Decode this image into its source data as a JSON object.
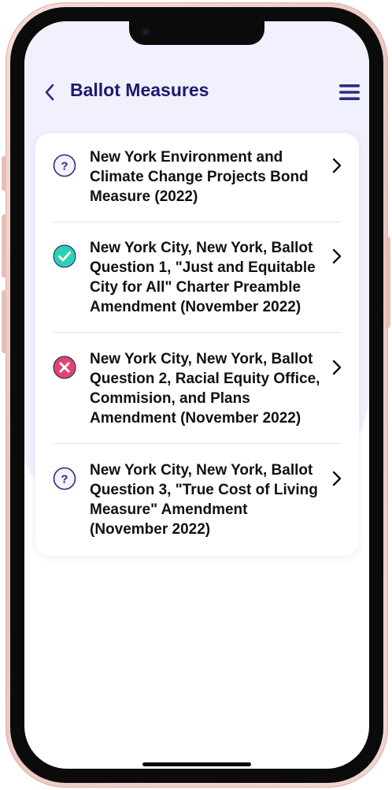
{
  "header": {
    "title": "Ballot Measures",
    "back_icon": "chevron-left-icon",
    "menu_icon": "hamburger-menu-icon"
  },
  "colors": {
    "title": "#1c1a6e",
    "accent": "#2e2a82",
    "check": "#2ad1b2",
    "cross": "#e0456f",
    "screen_tint": "#f0f1fd"
  },
  "measures": [
    {
      "status": "unknown",
      "status_icon": "question-icon",
      "title": "New York Environment and Climate Change Projects Bond Measure (2022)"
    },
    {
      "status": "passed",
      "status_icon": "check-icon",
      "title": "New York City, New York, Ballot Question 1, \"Just and Equitable City for All\" Charter Preamble Amendment (November 2022)"
    },
    {
      "status": "failed",
      "status_icon": "cross-icon",
      "title": "New York City, New York, Ballot Question 2, Racial Equity Office, Commision, and Plans Amendment (November 2022)"
    },
    {
      "status": "unknown",
      "status_icon": "question-icon",
      "title": "New York City, New York, Ballot Question 3, \"True Cost of Living Measure\" Amendment (November 2022)"
    }
  ]
}
